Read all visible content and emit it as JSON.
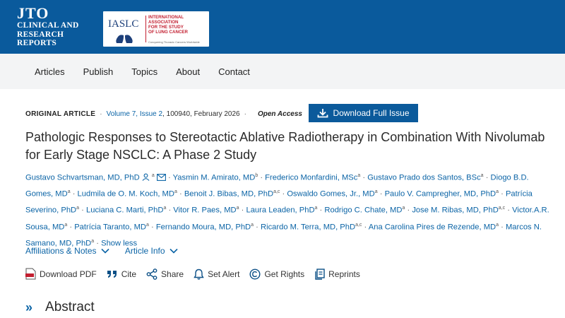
{
  "header": {
    "logo_main": "JTO",
    "logo_line1": "CLINICAL AND",
    "logo_line2": "RESEARCH",
    "logo_line3": "REPORTS",
    "partner_name": "IASLC",
    "partner_line1": "INTERNATIONAL",
    "partner_line2": "ASSOCIATION",
    "partner_line3": "FOR THE STUDY",
    "partner_line4": "OF LUNG CANCER",
    "partner_tagline": "Conquering Thoracic Cancers Worldwide"
  },
  "nav": {
    "items": [
      "Articles",
      "Publish",
      "Topics",
      "About",
      "Contact"
    ]
  },
  "article": {
    "type": "ORIGINAL ARTICLE",
    "volume": "Volume 7, Issue 2",
    "citation": ", 100940, February 2026",
    "access": "Open Access",
    "download_issue": "Download Full Issue",
    "title": "Pathologic Responses to Stereotactic Ablative Radiotherapy in Combination With Nivolumab for Early Stage NSCLC: A Phase 2 Study"
  },
  "authors": [
    {
      "name": "Gustavo Schvartsman, MD, PhD",
      "sup": "a"
    },
    {
      "name": "Yasmin M. Amirato, MD",
      "sup": "b"
    },
    {
      "name": "Frederico Monfardini, MSc",
      "sup": "a"
    },
    {
      "name": "Gustavo Prado dos Santos, BSc",
      "sup": "a"
    },
    {
      "name": "Diogo B.D. Gomes, MD",
      "sup": "a"
    },
    {
      "name": "Ludmila de O. M. Koch, MD",
      "sup": "a"
    },
    {
      "name": "Benoit J. Bibas, MD, PhD",
      "sup": "a,c"
    },
    {
      "name": "Oswaldo Gomes, Jr., MD",
      "sup": "a"
    },
    {
      "name": "Paulo V. Campregher, MD, PhD",
      "sup": "a"
    },
    {
      "name": "Patrícia Severino, PhD",
      "sup": "a"
    },
    {
      "name": "Luciana C. Marti, PhD",
      "sup": "a"
    },
    {
      "name": "Vitor R. Paes, MD",
      "sup": "a"
    },
    {
      "name": "Laura Leaden, PhD",
      "sup": "a"
    },
    {
      "name": "Rodrigo C. Chate, MD",
      "sup": "a"
    },
    {
      "name": "Jose M. Ribas, MD, PhD",
      "sup": "a,c"
    },
    {
      "name": "Victor.A.R. Sousa, MD",
      "sup": "a"
    },
    {
      "name": "Patrícia Taranto, MD",
      "sup": "a"
    },
    {
      "name": "Fernando Moura, MD, PhD",
      "sup": "a"
    },
    {
      "name": "Ricardo M. Terra, MD, PhD",
      "sup": "a,c"
    },
    {
      "name": "Ana Carolina Pires de Rezende, MD",
      "sup": "a"
    },
    {
      "name": "Marcos N. Samano, MD, PhD",
      "sup": "a"
    }
  ],
  "show_less": "Show less",
  "links": {
    "affiliations": "Affiliations & Notes",
    "article_info": "Article Info"
  },
  "tools": {
    "download_pdf": "Download PDF",
    "cite": "Cite",
    "share": "Share",
    "set_alert": "Set Alert",
    "get_rights": "Get Rights",
    "reprints": "Reprints"
  },
  "abstract_heading": "Abstract",
  "colors": {
    "header_blue": "#0a5a9c",
    "link_blue": "#0b64a6",
    "nav_bg": "#f3f4f5",
    "iaslc_red": "#c21f30"
  }
}
